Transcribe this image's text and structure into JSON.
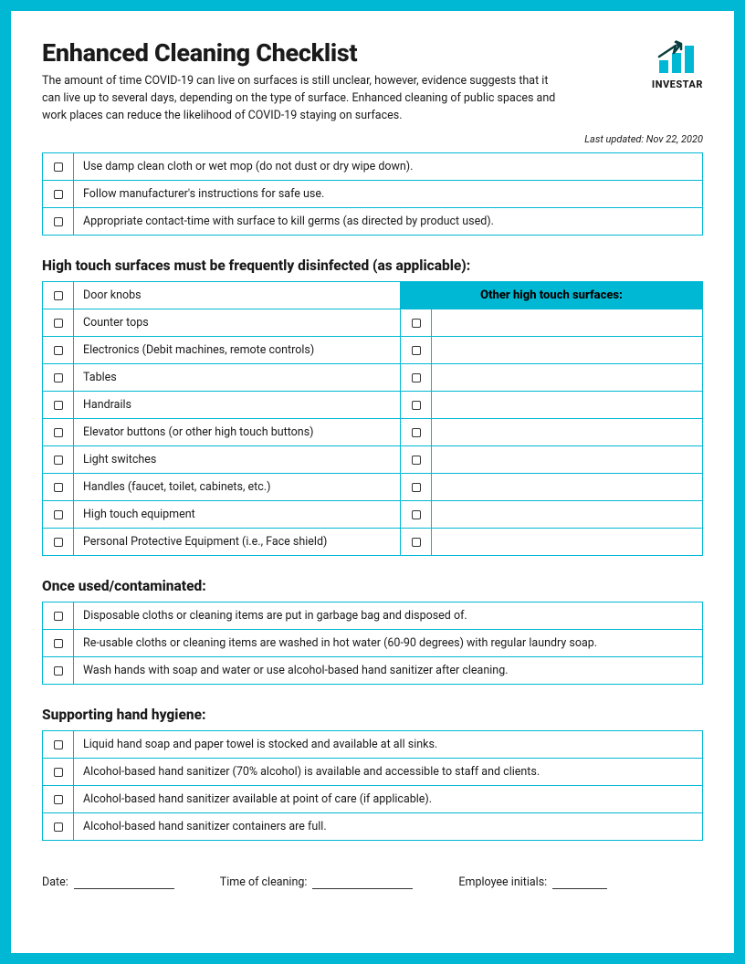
{
  "brand": "INVESTAR",
  "title": "Enhanced Cleaning Checklist",
  "subtitle": "The amount of time COVID-19 can live on surfaces is still unclear, however, evidence suggests that it can live up to several days, depending on the type of surface. Enhanced cleaning of public spaces and work places can reduce the likelihood of COVID-19 staying on surfaces.",
  "updated": "Last updated: Nov 22, 2020",
  "intro_items": [
    "Use damp clean cloth or wet mop (do not dust or dry wipe down).",
    "Follow manufacturer's instructions for safe use.",
    "Appropriate contact-time with surface to kill germs (as directed by product used)."
  ],
  "high_touch_title": "High touch surfaces must be frequently disinfected (as applicable):",
  "other_surfaces_header": "Other high touch surfaces:",
  "high_touch_items": [
    "Door knobs",
    "Counter tops",
    "Electronics (Debit machines, remote controls)",
    "Tables",
    "Handrails",
    "Elevator buttons (or other high touch buttons)",
    "Light switches",
    "Handles (faucet, toilet, cabinets, etc.)",
    "High touch equipment",
    "Personal Protective Equipment (i.e., Face shield)"
  ],
  "once_used_title": "Once used/contaminated:",
  "once_used_items": [
    "Disposable cloths or cleaning items are put in garbage bag and disposed of.",
    "Re-usable cloths or cleaning items are washed in hot water (60-90 degrees) with regular laundry soap.",
    "Wash hands with soap and water or use alcohol-based hand sanitizer after cleaning."
  ],
  "hygiene_title": "Supporting hand hygiene:",
  "hygiene_items": [
    "Liquid hand soap and paper towel is stocked and available at all sinks.",
    "Alcohol-based hand sanitizer (70% alcohol) is available and accessible to staff and clients.",
    "Alcohol-based hand sanitizer available at point of care (if applicable).",
    "Alcohol-based hand sanitizer containers are full."
  ],
  "footer": {
    "date": "Date:",
    "time": "Time of cleaning:",
    "initials": "Employee initials:"
  }
}
